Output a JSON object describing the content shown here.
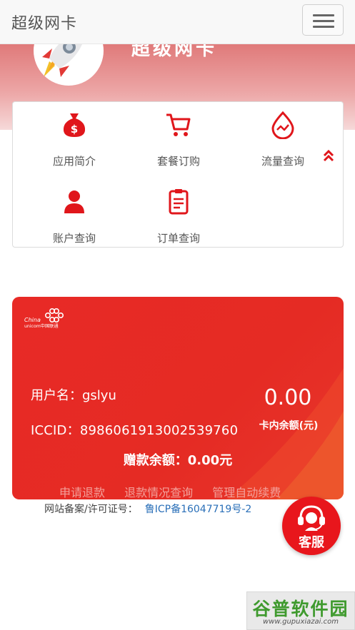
{
  "navbar": {
    "brand": "超级网卡"
  },
  "hero": {
    "title": "超级网卡"
  },
  "menu": {
    "items": [
      {
        "label": "应用简介",
        "icon": "money-bag-icon"
      },
      {
        "label": "套餐订购",
        "icon": "shopping-cart-icon"
      },
      {
        "label": "流量查询",
        "icon": "data-drop-icon"
      },
      {
        "label": "账户查询",
        "icon": "user-icon"
      },
      {
        "label": "订单查询",
        "icon": "clipboard-icon"
      }
    ],
    "collapse_icon": "chevron-up-icon"
  },
  "card": {
    "carrier_logo": "China unicom中国联通",
    "username_label": "用户名：",
    "username": "gslyu",
    "iccid_label": "ICCID：",
    "iccid": "89860619130025397​60",
    "balance": "0.00",
    "balance_label": "卡内余额(元)",
    "gift_label": "赠款余额：",
    "gift_value": "0.00元",
    "actions": [
      "申请退款",
      "退款情况查询",
      "管理自动续费"
    ]
  },
  "footer": {
    "icp_label": "网站备案/许可证号：",
    "icp_number": "鲁ICP备16047719号-2"
  },
  "kefu": {
    "label": "客服"
  },
  "watermark": {
    "title": "谷普软件园",
    "url": "www.gupuxiazai.com"
  },
  "colors": {
    "accent": "#e52b24",
    "hero": "#e9908f",
    "link": "#2a6fb8"
  }
}
